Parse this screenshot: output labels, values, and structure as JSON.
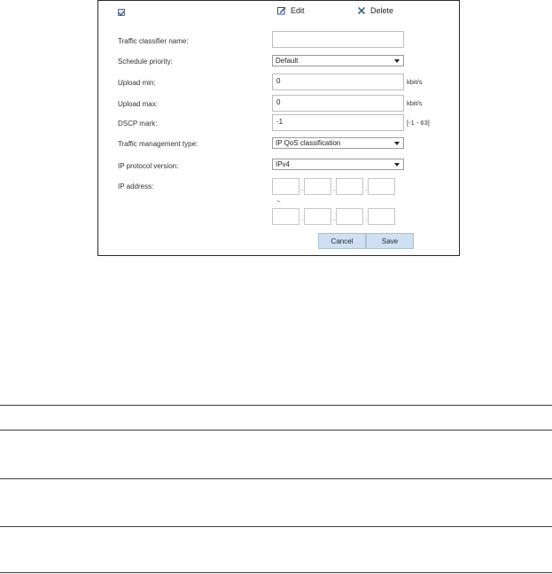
{
  "toolbar": {
    "edit_label": "Edit",
    "delete_label": "Delete"
  },
  "form": {
    "name_label": "Traffic classifier name:",
    "name_value": "",
    "priority_label": "Schedule priority:",
    "priority_value": "Default",
    "upload_min_label": "Upload min:",
    "upload_min_value": "0",
    "upload_min_unit": "kbit/s",
    "upload_max_label": "Upload max:",
    "upload_max_value": "0",
    "upload_max_unit": "kbit/s",
    "dscp_label": "DSCP mark:",
    "dscp_value": "-1",
    "dscp_range": "[-1 - 63]",
    "mgmt_type_label": "Traffic management type:",
    "mgmt_type_value": "IP QoS classification",
    "ip_version_label": "IP protocol version:",
    "ip_version_value": "IPv4",
    "ip_address_label": "IP address:",
    "range_separator": "~",
    "octet_separator": "."
  },
  "buttons": {
    "cancel_label": "Cancel",
    "save_label": "Save"
  },
  "colors": {
    "button_bg": "#cfe1f1",
    "border": "#2b2b2b",
    "checkbox": "#1f3a6e"
  },
  "icons": {
    "edit": "edit-pencil-icon",
    "delete": "close-x-icon",
    "checkbox": "checkbox-checked-icon"
  }
}
